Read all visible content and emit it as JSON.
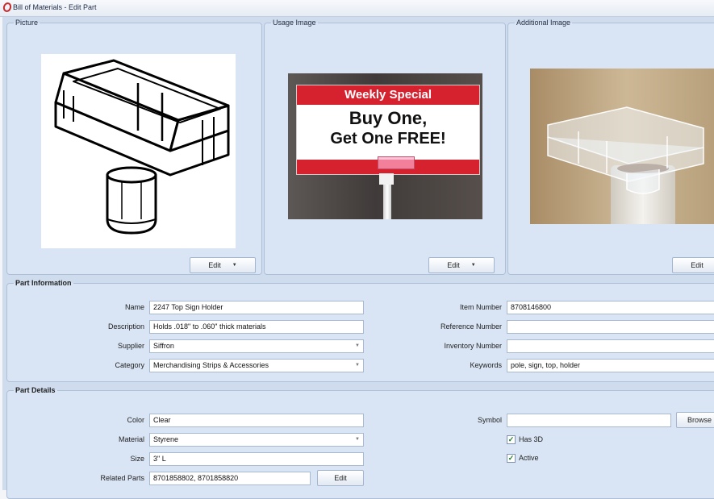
{
  "window": {
    "title": "Bill of Materials - Edit Part"
  },
  "images": {
    "picture": {
      "label": "Picture",
      "edit": "Edit"
    },
    "usage": {
      "label": "Usage Image",
      "edit": "Edit",
      "sign_line1": "Weekly Special",
      "sign_line2": "Buy One,",
      "sign_line3": "Get One FREE!"
    },
    "additional": {
      "label": "Additional Image",
      "edit": "Edit"
    }
  },
  "part_info": {
    "label": "Part Information",
    "name_label": "Name",
    "name": "2247 Top Sign Holder",
    "description_label": "Description",
    "description": "Holds .018\" to .060\" thick materials",
    "supplier_label": "Supplier",
    "supplier": "Siffron",
    "category_label": "Category",
    "category": "Merchandising Strips & Accessories",
    "item_number_label": "Item Number",
    "item_number": "8708146800",
    "reference_number_label": "Reference Number",
    "reference_number": "",
    "inventory_number_label": "Inventory Number",
    "inventory_number": "",
    "keywords_label": "Keywords",
    "keywords": "pole, sign, top, holder"
  },
  "part_details": {
    "label": "Part Details",
    "color_label": "Color",
    "color": "Clear",
    "material_label": "Material",
    "material": "Styrene",
    "size_label": "Size",
    "size": "3\" L",
    "related_label": "Related Parts",
    "related": "8701858802, 8701858820",
    "related_edit": "Edit",
    "symbol_label": "Symbol",
    "symbol": "",
    "browse": "Browse",
    "has3d_label": "Has 3D",
    "has3d": true,
    "active_label": "Active",
    "active": true
  },
  "icons": {
    "dropdown": "chevron-down-icon",
    "app": "app-logo-icon",
    "check": "checkmark-icon"
  }
}
